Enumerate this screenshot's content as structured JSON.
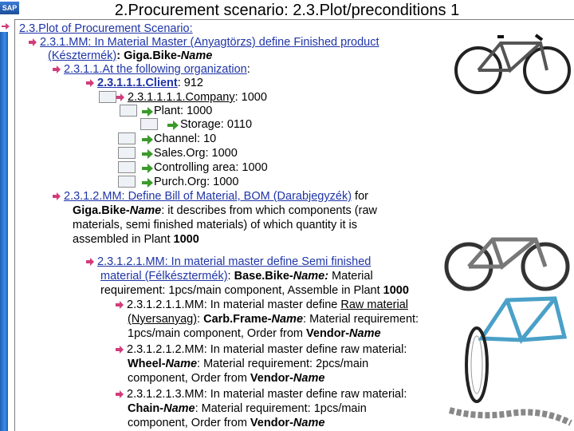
{
  "logo": "SAP",
  "title": "2.Procurement scenario: 2.3.Plot/preconditions 1",
  "outline": {
    "h1": "2.3.Plot of Procurement Scenario:",
    "h2_a": "2.3.1.MM: In Material Master (Anyagtörzs) define Finished product",
    "h2_b": "(Késztermék)",
    "h2_c": ": Giga.Bike-",
    "h2_d": "Name",
    "h3_a": "2.3.1.1.At the following organization",
    "h3_b": ":",
    "client_a": "2.3.1.1.1.Client",
    "client_b": ": 912",
    "company_a": "2.3.1.1.1.1.Company",
    "company_b": ": 1000",
    "plant": "Plant: 1000",
    "storage": "Storage: 0110",
    "channel": "Channel: 10",
    "salesorg": "Sales.Org: 1000",
    "controlling": "Controlling area: 1000",
    "purchorg": "Purch.Org: 1000",
    "bom_a": "2.3.1.2.MM: Define ",
    "bom_b": "Bill of Material, BOM (Darabjegyzék)",
    "bom_c": " for",
    "bom2_a": "Giga.Bike-",
    "bom2_b": "Name",
    "bom2_c": ": it describes from which components (raw",
    "bom3": "materials, semi finished materials) of which quantity it is",
    "bom4_a": "assembled in Plant ",
    "bom4_b": "1000",
    "semi1": "2.3.1.2.1.MM: In material master define Semi finished",
    "semi2_a": "material (Félkésztermék)",
    "semi2_b": ": ",
    "semi2_c": "Base.Bike-",
    "semi2_d": "Name:",
    "semi2_e": " Material",
    "semi3_a": "requirement: 1pcs/main component, Assemble in Plant ",
    "semi3_b": "1000",
    "raw1_a": "2.3.1.2.1.1.MM: In material master define ",
    "raw1_b": "Raw material",
    "raw2_a": "(Nyersanyag)",
    "raw2_b": ": ",
    "raw2_c": "Carb.Frame-",
    "raw2_d": "Name",
    "raw2_e": ": Material requirement:",
    "raw3_a": "1pcs/main component, Order from ",
    "raw3_b": "Vendor-",
    "raw3_c": "Name",
    "wheel1": "2.3.1.2.1.2.MM: In material master define raw material:",
    "wheel2_a": "Wheel-",
    "wheel2_b": "Name",
    "wheel2_c": ": Material requirement: 2pcs/main",
    "wheel3_a": "component, Order from ",
    "wheel3_b": "Vendor-",
    "wheel3_c": "Name",
    "chain1": "2.3.1.2.1.3.MM: In material master define raw material:",
    "chain2_a": "Chain-",
    "chain2_b": "Name",
    "chain2_c": ": Material requirement: 1pcs/main",
    "chain3_a": "component, Order from ",
    "chain3_b": "Vendor-",
    "chain3_c": "Name"
  },
  "colors": {
    "accent_blue": "#1f35a8",
    "arrow_pink": "#d23c7a",
    "arrow_green": "#3a9a2a",
    "sidebar_blue": "#2a72cf"
  }
}
